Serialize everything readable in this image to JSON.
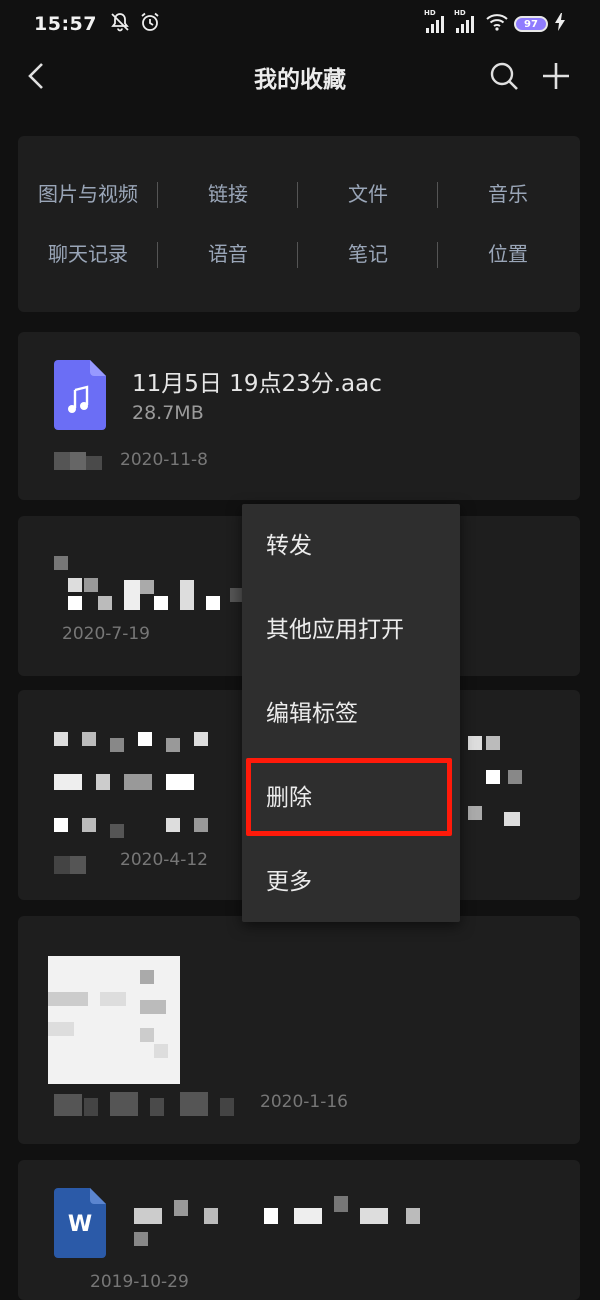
{
  "status_bar": {
    "time": "15:57",
    "signal_label_1": "HD",
    "signal_label_2": "HD",
    "battery_level": "97",
    "icons": [
      "mute-bell-icon",
      "alarm-icon",
      "signal-icon",
      "wifi-icon",
      "battery-icon",
      "charging-icon"
    ]
  },
  "header": {
    "title": "我的收藏",
    "icons": [
      "back-arrow-icon",
      "search-icon",
      "plus-icon"
    ]
  },
  "categories": {
    "row1": [
      "图片与视频",
      "链接",
      "文件",
      "音乐"
    ],
    "row2": [
      "聊天记录",
      "语音",
      "笔记",
      "位置"
    ]
  },
  "cards": [
    {
      "file_name": "11月5日 19点23分.aac",
      "file_size": "28.7MB",
      "date": "2020-11-8",
      "icon": "music-file-icon",
      "icon_color": "#6b6ef5"
    },
    {
      "date": "2020-7-19"
    },
    {
      "date": "2020-4-12"
    },
    {
      "date": "2020-1-16"
    },
    {
      "date": "2019-10-29",
      "icon": "word-file-icon",
      "icon_label": "W",
      "icon_color": "#2b5aa8"
    }
  ],
  "context_menu": {
    "items": [
      "转发",
      "其他应用打开",
      "编辑标签",
      "删除",
      "更多"
    ],
    "highlighted_item": "删除",
    "highlight_color": "#ff1a0a"
  }
}
